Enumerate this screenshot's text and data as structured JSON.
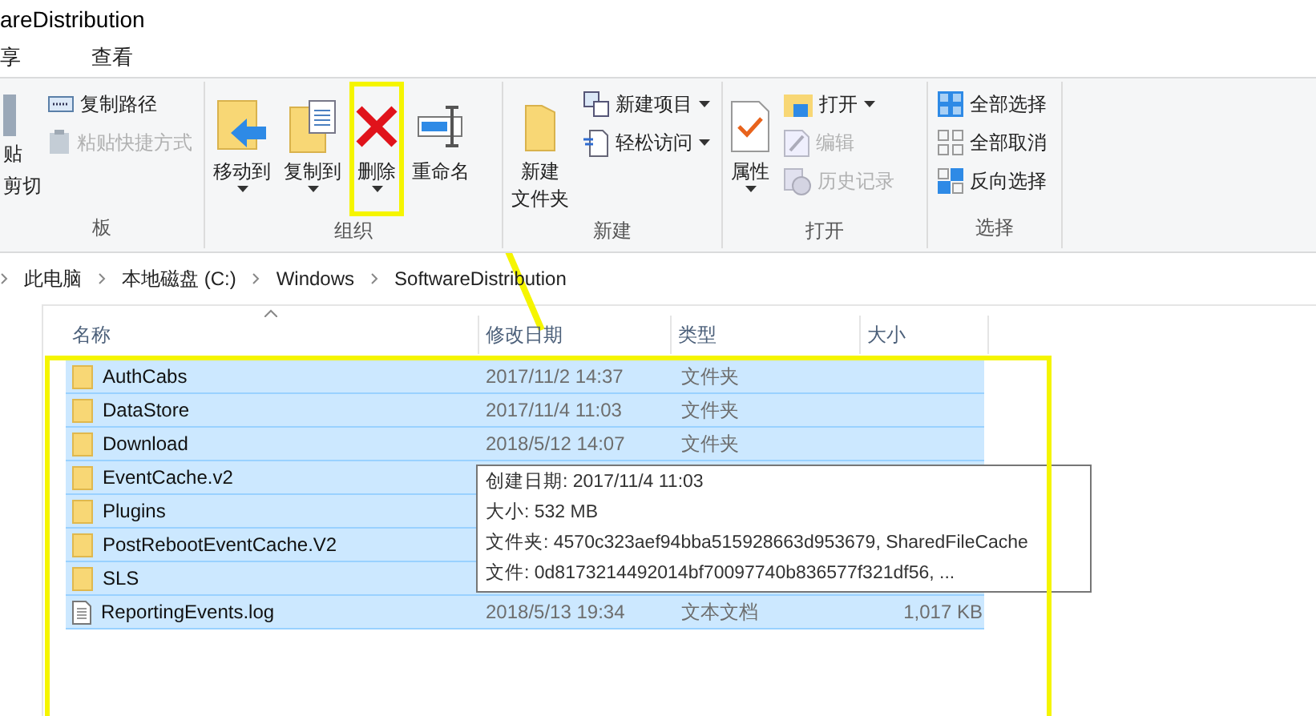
{
  "window": {
    "title": "areDistribution"
  },
  "menu": [
    {
      "label": "享"
    },
    {
      "label": "查看"
    }
  ],
  "ribbon": {
    "groups": [
      {
        "label": "板",
        "items": [
          {
            "kind": "large",
            "label": "贴"
          },
          {
            "kind": "under",
            "label": "剪切"
          },
          {
            "kind": "small",
            "label": "复制路径",
            "disabled": false
          },
          {
            "kind": "small",
            "label": "粘贴快捷方式",
            "disabled": true
          }
        ]
      },
      {
        "label": "组织",
        "items": [
          {
            "kind": "large",
            "label": "移动到",
            "dropdown": true,
            "highlighted": false
          },
          {
            "kind": "large",
            "label": "复制到",
            "dropdown": true,
            "highlighted": false
          },
          {
            "kind": "large",
            "label": "删除",
            "dropdown": true,
            "highlighted": true
          },
          {
            "kind": "large",
            "label": "重命名",
            "dropdown": false,
            "highlighted": false
          }
        ]
      },
      {
        "label": "新建",
        "items": [
          {
            "kind": "large",
            "lines": [
              "新建",
              "文件夹"
            ],
            "dropdown": false
          },
          {
            "kind": "small",
            "label": "新建项目",
            "dropdown": true,
            "disabled": false
          },
          {
            "kind": "small",
            "label": "轻松访问",
            "dropdown": true,
            "disabled": false
          }
        ]
      },
      {
        "label": "打开",
        "items": [
          {
            "kind": "large",
            "label": "属性",
            "dropdown": true
          },
          {
            "kind": "small",
            "label": "打开",
            "dropdown": true,
            "disabled": false
          },
          {
            "kind": "small",
            "label": "编辑",
            "dropdown": false,
            "disabled": true
          },
          {
            "kind": "small",
            "label": "历史记录",
            "dropdown": false,
            "disabled": true
          }
        ]
      },
      {
        "label": "选择",
        "items": [
          {
            "kind": "small",
            "label": "全部选择",
            "disabled": false
          },
          {
            "kind": "small",
            "label": "全部取消",
            "disabled": false
          },
          {
            "kind": "small",
            "label": "反向选择",
            "disabled": false
          }
        ]
      }
    ]
  },
  "breadcrumb": [
    "此电脑",
    "本地磁盘 (C:)",
    "Windows",
    "SoftwareDistribution"
  ],
  "table": {
    "columns": [
      "名称",
      "修改日期",
      "类型",
      "大小"
    ],
    "rows": [
      {
        "kind": "folder",
        "name": "AuthCabs",
        "date": "2017/11/2 14:37",
        "type": "文件夹",
        "selected": true
      },
      {
        "kind": "folder",
        "name": "DataStore",
        "date": "2017/11/4 11:03",
        "type": "文件夹",
        "selected": true
      },
      {
        "kind": "folder",
        "name": "Download",
        "date": "2018/5/12 14:07",
        "type": "文件夹",
        "selected": true
      },
      {
        "kind": "folder",
        "name": "EventCache.v2",
        "selected": true
      },
      {
        "kind": "folder",
        "name": "Plugins",
        "selected": true
      },
      {
        "kind": "folder",
        "name": "PostRebootEventCache.V2",
        "selected": true
      },
      {
        "kind": "folder",
        "name": "SLS",
        "selected": true
      },
      {
        "kind": "file",
        "name": "ReportingEvents.log",
        "date": "2018/5/13 19:34",
        "type": "文本文档",
        "size": "1,017 KB",
        "selected": true
      }
    ]
  },
  "tooltip": {
    "lines": [
      "创建日期: 2017/11/4 11:03",
      "大小: 532 MB",
      "文件夹: 4570c323aef94bba515928663d953679, SharedFileCache",
      "文件: 0d8173214492014bf70097740b836577f321df56, ..."
    ]
  }
}
